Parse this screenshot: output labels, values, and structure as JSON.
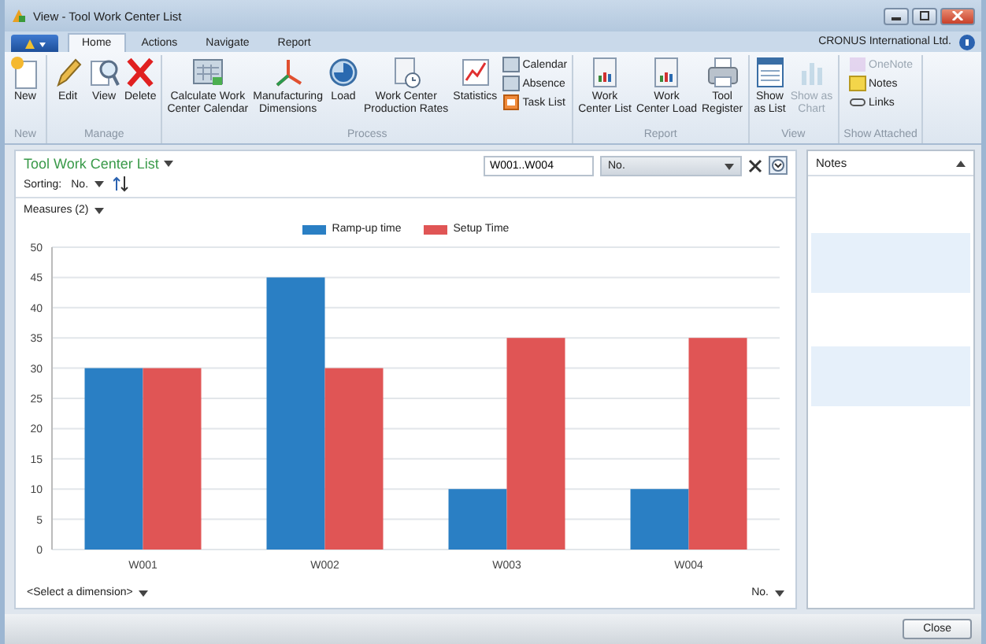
{
  "window": {
    "title": "View - Tool Work Center List"
  },
  "tabs": [
    {
      "label": "Home",
      "selected": true
    },
    {
      "label": "Actions",
      "selected": false
    },
    {
      "label": "Navigate",
      "selected": false
    },
    {
      "label": "Report",
      "selected": false
    }
  ],
  "company": "CRONUS International Ltd.",
  "ribbon": {
    "groups": [
      {
        "label": "New",
        "buttons": [
          {
            "label": "New",
            "kind": "large",
            "disabled": false
          }
        ]
      },
      {
        "label": "Manage",
        "buttons": [
          {
            "label": "Edit",
            "kind": "large",
            "disabled": false
          },
          {
            "label": "View",
            "kind": "large",
            "disabled": false
          },
          {
            "label": "Delete",
            "kind": "large",
            "disabled": false
          }
        ]
      },
      {
        "label": "Process",
        "buttons": [
          {
            "label": "Calculate Work\nCenter Calendar",
            "kind": "large",
            "disabled": false
          },
          {
            "label": "Manufacturing\nDimensions",
            "kind": "large",
            "disabled": false
          },
          {
            "label": "Load",
            "kind": "large",
            "disabled": false
          },
          {
            "label": "Work Center\nProduction Rates",
            "kind": "large",
            "disabled": false
          },
          {
            "label": "Statistics",
            "kind": "large",
            "disabled": false
          },
          {
            "label": "Calendar",
            "kind": "small",
            "disabled": false
          },
          {
            "label": "Absence",
            "kind": "small",
            "disabled": false
          },
          {
            "label": "Task List",
            "kind": "small",
            "disabled": false
          }
        ]
      },
      {
        "label": "Report",
        "buttons": [
          {
            "label": "Work\nCenter List",
            "kind": "large",
            "disabled": false
          },
          {
            "label": "Work\nCenter Load",
            "kind": "large",
            "disabled": false
          },
          {
            "label": "Tool\nRegister",
            "kind": "large",
            "disabled": false
          }
        ]
      },
      {
        "label": "View",
        "buttons": [
          {
            "label": "Show\nas List",
            "kind": "large",
            "disabled": false
          },
          {
            "label": "Show as\nChart",
            "kind": "large",
            "disabled": true
          }
        ]
      },
      {
        "label": "Show Attached",
        "buttons": [
          {
            "label": "OneNote",
            "kind": "small",
            "disabled": true
          },
          {
            "label": "Notes",
            "kind": "small",
            "disabled": false
          },
          {
            "label": "Links",
            "kind": "small",
            "disabled": false
          }
        ]
      }
    ]
  },
  "page": {
    "title": "Tool Work Center List",
    "sorting_label": "Sorting:",
    "sorting_field": "No.",
    "filter": {
      "value": "W001..W004",
      "field": "No."
    },
    "measures": "Measures (2)",
    "chart_data": {
      "type": "bar",
      "categories": [
        "W001",
        "W002",
        "W003",
        "W004"
      ],
      "series": [
        {
          "name": "Ramp-up time",
          "color": "#2a7fc4",
          "values": [
            30,
            45,
            10,
            10
          ]
        },
        {
          "name": "Setup Time",
          "color": "#e05555",
          "values": [
            30,
            30,
            35,
            35
          ]
        }
      ],
      "ylim": [
        0,
        50
      ],
      "grid": true,
      "yticks": [
        0,
        5,
        10,
        15,
        20,
        25,
        30,
        35,
        40,
        45,
        50
      ]
    },
    "dimension": "<Select a dimension>",
    "x_field": "No."
  },
  "factbox": {
    "title": "Notes"
  },
  "footer": {
    "close": "Close"
  }
}
